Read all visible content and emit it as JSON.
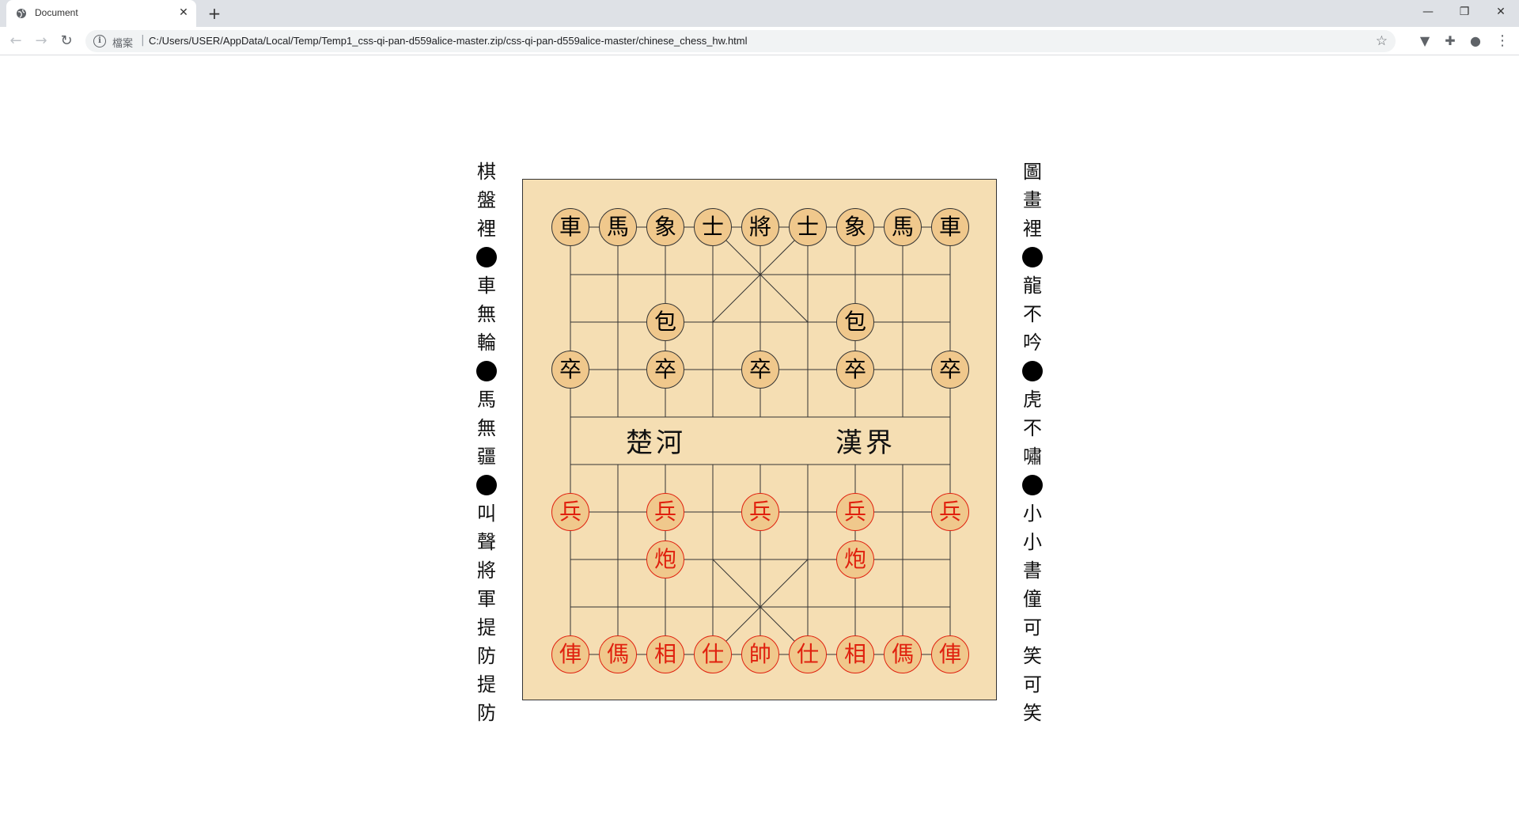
{
  "browser": {
    "tab_title": "Document",
    "tab_close": "✕",
    "new_tab": "+",
    "window_minimize": "—",
    "window_maximize": "❐",
    "window_close": "✕",
    "back": "←",
    "forward": "→",
    "reload": "↻",
    "info_icon": "i",
    "file_label": "檔案",
    "separator": "|",
    "url": "C:/Users/USER/AppData/Local/Temp/Temp1_css-qi-pan-d559alice-master.zip/css-qi-pan-d559alice-master/chinese_chess_hw.html",
    "bookmark_star": "☆",
    "ext1_icon": "▼",
    "ext2_icon": "✚",
    "profile_icon": "●",
    "menu_icon": "⋮"
  },
  "poem_left": [
    "棋",
    "盤",
    "裡",
    "●",
    "車",
    "無",
    "輪",
    "●",
    "馬",
    "無",
    "疆",
    "●",
    "叫",
    "聲",
    "將",
    "軍",
    "提",
    "防",
    "提",
    "防"
  ],
  "poem_right": [
    "圖",
    "畫",
    "裡",
    "●",
    "龍",
    "不",
    "吟",
    "●",
    "虎",
    "不",
    "嘯",
    "●",
    "小",
    "小",
    "書",
    "僮",
    "可",
    "笑",
    "可",
    "笑"
  ],
  "board": {
    "river_left": "楚河",
    "river_right": "漢界",
    "colors": {
      "background": "#f5deb3",
      "piece_fill": "#f0c88c",
      "red": "#e0200e",
      "black": "#000000"
    },
    "black_pieces": [
      {
        "label": "車",
        "col": 0,
        "row": 0
      },
      {
        "label": "馬",
        "col": 1,
        "row": 0
      },
      {
        "label": "象",
        "col": 2,
        "row": 0
      },
      {
        "label": "士",
        "col": 3,
        "row": 0
      },
      {
        "label": "將",
        "col": 4,
        "row": 0
      },
      {
        "label": "士",
        "col": 5,
        "row": 0
      },
      {
        "label": "象",
        "col": 6,
        "row": 0
      },
      {
        "label": "馬",
        "col": 7,
        "row": 0
      },
      {
        "label": "車",
        "col": 8,
        "row": 0
      },
      {
        "label": "包",
        "col": 2,
        "row": 2
      },
      {
        "label": "包",
        "col": 6,
        "row": 2
      },
      {
        "label": "卒",
        "col": 0,
        "row": 3
      },
      {
        "label": "卒",
        "col": 2,
        "row": 3
      },
      {
        "label": "卒",
        "col": 4,
        "row": 3
      },
      {
        "label": "卒",
        "col": 6,
        "row": 3
      },
      {
        "label": "卒",
        "col": 8,
        "row": 3
      }
    ],
    "red_pieces": [
      {
        "label": "兵",
        "col": 0,
        "row": 6
      },
      {
        "label": "兵",
        "col": 2,
        "row": 6
      },
      {
        "label": "兵",
        "col": 4,
        "row": 6
      },
      {
        "label": "兵",
        "col": 6,
        "row": 6
      },
      {
        "label": "兵",
        "col": 8,
        "row": 6
      },
      {
        "label": "炮",
        "col": 2,
        "row": 7
      },
      {
        "label": "炮",
        "col": 6,
        "row": 7
      },
      {
        "label": "俥",
        "col": 0,
        "row": 9
      },
      {
        "label": "傌",
        "col": 1,
        "row": 9
      },
      {
        "label": "相",
        "col": 2,
        "row": 9
      },
      {
        "label": "仕",
        "col": 3,
        "row": 9
      },
      {
        "label": "帥",
        "col": 4,
        "row": 9
      },
      {
        "label": "仕",
        "col": 5,
        "row": 9
      },
      {
        "label": "相",
        "col": 6,
        "row": 9
      },
      {
        "label": "傌",
        "col": 7,
        "row": 9
      },
      {
        "label": "俥",
        "col": 8,
        "row": 9
      }
    ]
  }
}
